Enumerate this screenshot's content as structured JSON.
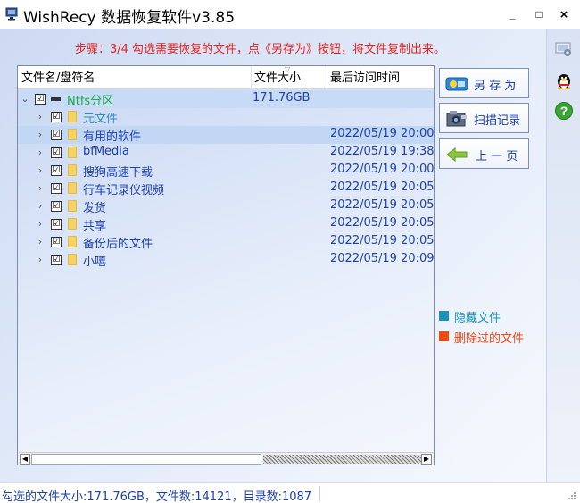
{
  "window": {
    "title": "WishRecy 数据恢复软件v3.85",
    "minimize": "_",
    "maximize": "□",
    "close": "×"
  },
  "step_instruction": "步骤：3/4 勾选需要恢复的文件，点《另存为》按钮，将文件复制出来。",
  "columns": {
    "name": "文件名/盘符名",
    "size": "文件大小",
    "date": "最后访问时间"
  },
  "tree": {
    "root": {
      "name": "Ntfs分区",
      "size": "171.76GB",
      "checked": "☑"
    },
    "items": [
      {
        "name": "元文件",
        "date": "",
        "checked": "☑"
      },
      {
        "name": "有用的软件",
        "date": "2022/05/19 20:00:",
        "checked": "☑"
      },
      {
        "name": "bfMedia",
        "date": "2022/05/19 19:38:",
        "checked": "☑"
      },
      {
        "name": "搜狗高速下载",
        "date": "2022/05/19 20:00:",
        "checked": "☑"
      },
      {
        "name": "行车记录仪视频",
        "date": "2022/05/19 20:05:",
        "checked": "☑"
      },
      {
        "name": "发货",
        "date": "2022/05/19 20:05:",
        "checked": "☑"
      },
      {
        "name": "共享",
        "date": "2022/05/19 20:05:",
        "checked": "☑"
      },
      {
        "name": "备份后的文件",
        "date": "2022/05/19 20:05:",
        "checked": "☑"
      },
      {
        "name": "小嘻",
        "date": "2022/05/19 20:09:",
        "checked": "☑"
      }
    ]
  },
  "buttons": {
    "save_as": "另 存 为",
    "scan_record": "扫描记录",
    "previous": "上 一 页"
  },
  "legend": {
    "hidden": {
      "label": "隐藏文件",
      "color": "#1a93b7"
    },
    "deleted": {
      "label": "删除过的文件",
      "color": "#f04a14"
    }
  },
  "status": "勾选的文件大小:171.76GB，文件数:14121，目录数:1087",
  "colors": {
    "accent_text": "#1a3fb5",
    "warning_text": "#e8231e",
    "partition_name": "#1ba848",
    "meta_folder": "#2a8fc7"
  }
}
